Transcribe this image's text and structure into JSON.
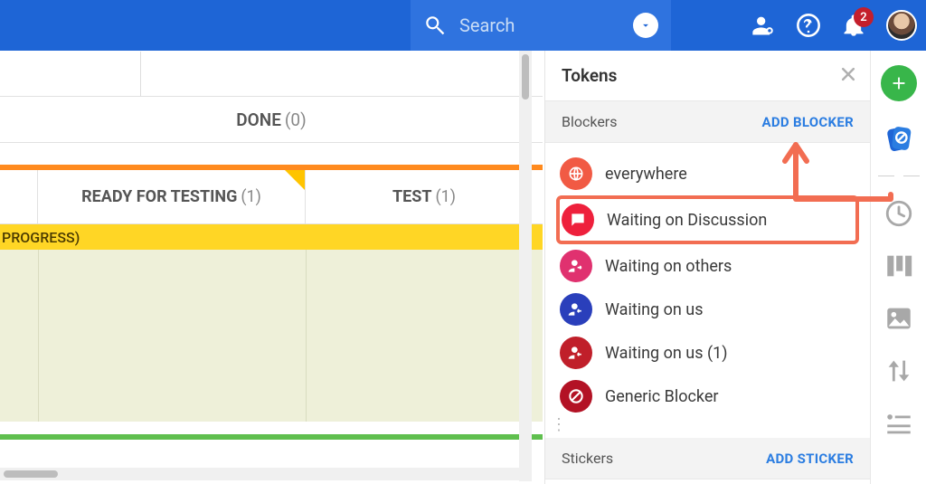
{
  "header": {
    "search_placeholder": "Search",
    "notification_count": "2"
  },
  "board": {
    "done_label": "DONE",
    "done_count": "(0)",
    "lanes": [
      {
        "label": "READY FOR TESTING",
        "count": "(1)"
      },
      {
        "label": "TEST",
        "count": "(1)"
      }
    ],
    "swimlane_label": "PROGRESS)"
  },
  "panel": {
    "title": "Tokens",
    "sections": {
      "blockers": {
        "label": "Blockers",
        "action": "ADD BLOCKER"
      },
      "stickers": {
        "label": "Stickers",
        "action": "ADD STICKER"
      }
    },
    "blockers": [
      {
        "name": "everywhere",
        "color": "#f15a44",
        "icon": "globe"
      },
      {
        "name": "Waiting on Discussion",
        "color": "#ee203c",
        "icon": "chat",
        "highlight": true
      },
      {
        "name": "Waiting on others",
        "color": "#e0316f",
        "icon": "person-out"
      },
      {
        "name": "Waiting on us",
        "color": "#2a3fbb",
        "icon": "person-in"
      },
      {
        "name": "Waiting on us (1)",
        "color": "#c01f2a",
        "icon": "person-in"
      },
      {
        "name": "Generic Blocker",
        "color": "#b31225",
        "icon": "block"
      }
    ]
  },
  "sidebar": {
    "items": [
      "add",
      "tokens",
      "sep",
      "recent",
      "board",
      "image",
      "updown",
      "list"
    ]
  }
}
